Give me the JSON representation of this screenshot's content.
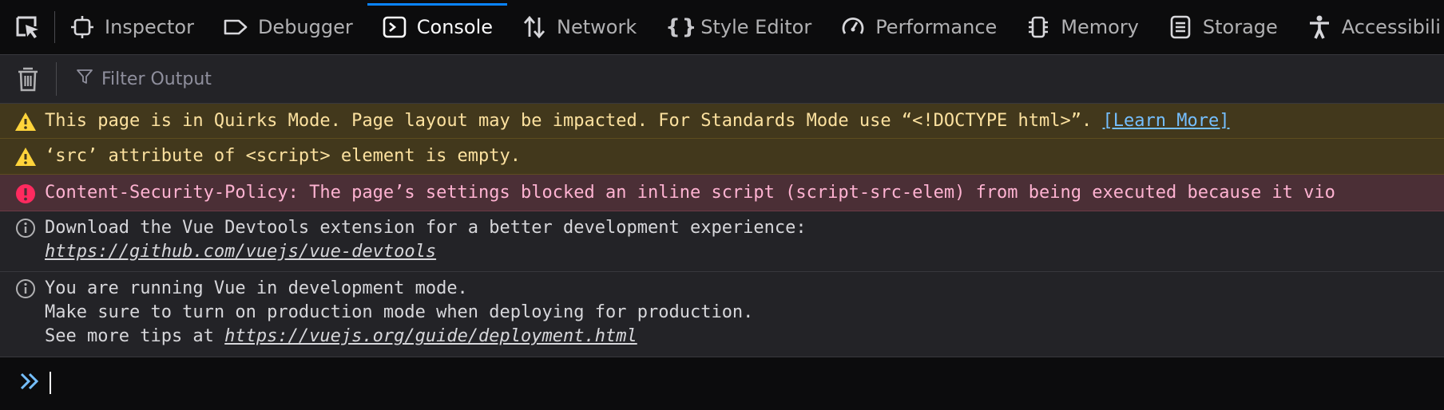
{
  "toolbar": {
    "picker_icon": "element-picker-icon",
    "tabs": [
      {
        "label": "Inspector",
        "icon": "inspector-icon",
        "selected": false
      },
      {
        "label": "Debugger",
        "icon": "debugger-icon",
        "selected": false
      },
      {
        "label": "Console",
        "icon": "console-icon",
        "selected": true
      },
      {
        "label": "Network",
        "icon": "network-icon",
        "selected": false
      },
      {
        "label": "Style Editor",
        "icon": "style-editor-icon",
        "selected": false
      },
      {
        "label": "Performance",
        "icon": "performance-icon",
        "selected": false
      },
      {
        "label": "Memory",
        "icon": "memory-icon",
        "selected": false
      },
      {
        "label": "Storage",
        "icon": "storage-icon",
        "selected": false
      },
      {
        "label": "Accessibili",
        "icon": "accessibility-icon",
        "selected": false
      }
    ]
  },
  "filterbar": {
    "trash_icon": "trash-icon",
    "filter_icon": "filter-icon",
    "filter_placeholder": "Filter Output",
    "filter_value": ""
  },
  "messages": [
    {
      "type": "warning",
      "icon": "warning-icon",
      "text": "This page is in Quirks Mode. Page layout may be impacted. For Standards Mode use “<!DOCTYPE html>”.",
      "link": "[Learn More]"
    },
    {
      "type": "warning",
      "icon": "warning-icon",
      "text": "‘src’ attribute of <script> element is empty."
    },
    {
      "type": "error",
      "icon": "error-icon",
      "text": "Content-Security-Policy: The page’s settings blocked an inline script (script-src-elem) from being executed because it vio"
    },
    {
      "type": "info",
      "icon": "info-icon",
      "line1": "Download the Vue Devtools extension for a better development experience:",
      "url": "https://github.com/vuejs/vue-devtools"
    },
    {
      "type": "info",
      "icon": "info-icon",
      "line1": "You are running Vue in development mode.",
      "line2": "Make sure to turn on production mode when deploying for production.",
      "line3_prefix": "See more tips at ",
      "url": "https://vuejs.org/guide/deployment.html"
    }
  ],
  "console_input": {
    "prompt_icon": "double-chevron-icon",
    "value": ""
  },
  "colors": {
    "accent": "#0a84ff",
    "warning_bg": "#42381c",
    "error_bg": "#4b2f36",
    "link_blue": "#75bfff"
  }
}
